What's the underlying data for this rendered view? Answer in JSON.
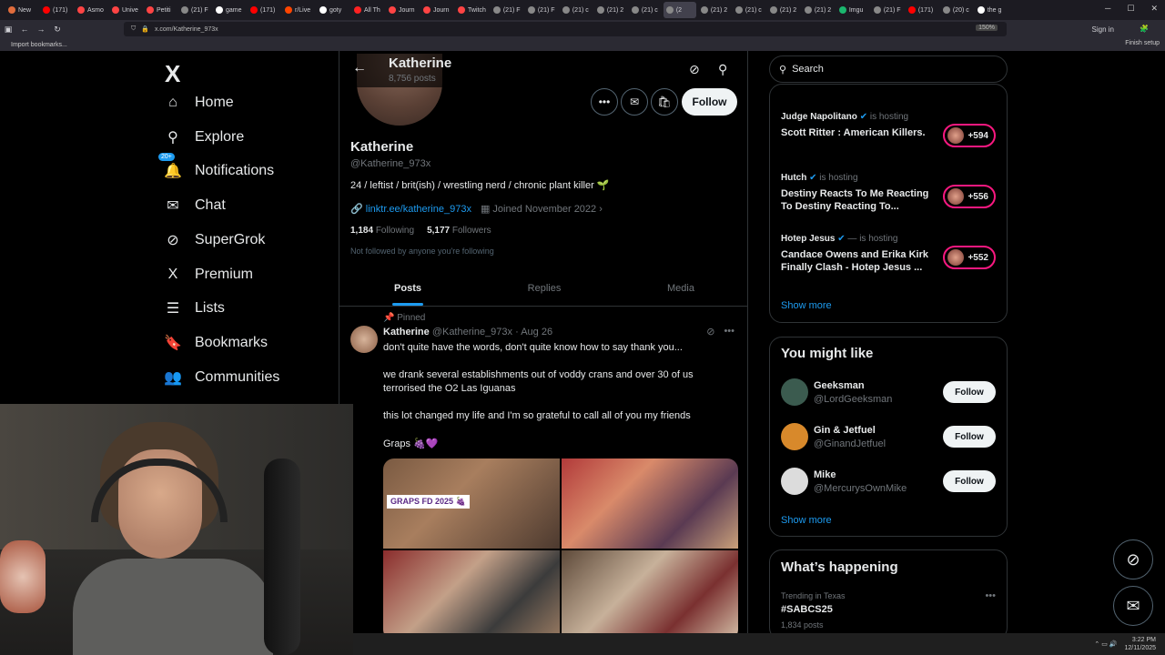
{
  "browser": {
    "tabs": [
      {
        "label": "New",
        "color": "#e06c3c"
      },
      {
        "label": "(171)",
        "color": "#ff0000"
      },
      {
        "label": "Asmo",
        "color": "#ff4444"
      },
      {
        "label": "Unive",
        "color": "#ff4444"
      },
      {
        "label": "Petiti",
        "color": "#ff4444"
      },
      {
        "label": "(21) F",
        "color": "#888888"
      },
      {
        "label": "game",
        "color": "#ffffff"
      },
      {
        "label": "(171)",
        "color": "#ff0000"
      },
      {
        "label": "r/Live",
        "color": "#ff4500"
      },
      {
        "label": "goty",
        "color": "#ffffff"
      },
      {
        "label": "All Th",
        "color": "#ff2222"
      },
      {
        "label": "Journ",
        "color": "#ff4444"
      },
      {
        "label": "Journ",
        "color": "#ff4444"
      },
      {
        "label": "Twitch",
        "color": "#ff4444"
      },
      {
        "label": "(21) F",
        "color": "#888888"
      },
      {
        "label": "(21) F",
        "color": "#888888"
      },
      {
        "label": "(21) c",
        "color": "#888888"
      },
      {
        "label": "(21) 2",
        "color": "#888888"
      },
      {
        "label": "(21) c",
        "color": "#888888"
      },
      {
        "label": "(2",
        "color": "#888888"
      },
      {
        "label": "(21) 2",
        "color": "#888888"
      },
      {
        "label": "(21) c",
        "color": "#888888"
      },
      {
        "label": "(21) 2",
        "color": "#888888"
      },
      {
        "label": "(21) 2",
        "color": "#888888"
      },
      {
        "label": "Imgu",
        "color": "#1bb76e"
      },
      {
        "label": "(21) F",
        "color": "#888888"
      },
      {
        "label": "(171)",
        "color": "#ff0000"
      },
      {
        "label": "(20) c",
        "color": "#888888"
      },
      {
        "label": "the g",
        "color": "#ffffff"
      }
    ],
    "active_tab_index": 19,
    "url": "x.com/Katherine_973x",
    "zoom": "150%",
    "sign_in": "Sign in",
    "bookmark": "Import bookmarks...",
    "finish_setup": "Finish setup"
  },
  "left_nav": {
    "logo": "X",
    "items": [
      {
        "label": "Home",
        "icon": "home-icon",
        "glyph": "⌂"
      },
      {
        "label": "Explore",
        "icon": "search-icon",
        "glyph": "⚲"
      },
      {
        "label": "Notifications",
        "icon": "bell-icon",
        "glyph": "🔔"
      },
      {
        "label": "Chat",
        "icon": "mail-icon",
        "glyph": "✉"
      },
      {
        "label": "SuperGrok",
        "icon": "grok-icon",
        "glyph": "⊘"
      },
      {
        "label": "Premium",
        "icon": "x-premium-icon",
        "glyph": "X"
      },
      {
        "label": "Lists",
        "icon": "list-icon",
        "glyph": "☰"
      },
      {
        "label": "Bookmarks",
        "icon": "bookmark-icon",
        "glyph": "🔖"
      },
      {
        "label": "Communities",
        "icon": "communities-icon",
        "glyph": "👥"
      }
    ],
    "notif_badge": "20+"
  },
  "profile": {
    "header_name": "Katherine",
    "header_posts": "8,756 posts",
    "follow_label": "Follow",
    "name": "Katherine",
    "handle": "@Katherine_973x",
    "bio": "24 / leftist / brit(ish) / wrestling nerd / chronic plant killer 🌱",
    "link": "linktr.ee/katherine_973x",
    "joined": "Joined November 2022",
    "following_count": "1,184",
    "following_label": "Following",
    "followers_count": "5,177",
    "followers_label": "Followers",
    "not_followed": "Not followed by anyone you're following",
    "tabs": [
      "Posts",
      "Replies",
      "Media"
    ]
  },
  "tweet": {
    "pinned_label": "Pinned",
    "author": "Katherine",
    "handle_date": "@Katherine_973x · Aug 26",
    "lines": [
      "don't quite have the words, don't quite know how to say thank you...",
      "we drank several establishments out of voddy crans and over 30 of us",
      "terrorised the O2 Las Iguanas",
      "this lot changed my life and I'm so grateful to call all of you my friends",
      "Graps 🍇💜"
    ],
    "media_label": "GRAPS FD 2025 🍇"
  },
  "right": {
    "search_placeholder": "Search",
    "spaces": [
      {
        "host": "Judge Napolitano",
        "hosting": "is hosting",
        "title": "Scott Ritter : American Killers.",
        "count": "+594"
      },
      {
        "host": "Hutch",
        "hosting": "is hosting",
        "title": "Destiny Reacts To Me Reacting To Destiny Reacting To...",
        "count": "+556"
      },
      {
        "host": "Hotep Jesus",
        "hosting": "— is hosting",
        "title": "Candace Owens and Erika Kirk Finally Clash - Hotep Jesus ...",
        "count": "+552"
      }
    ],
    "show_more": "Show more",
    "wtf_title": "You might like",
    "wtf": [
      {
        "name": "Geeksman",
        "handle": "@LordGeeksman",
        "btn": "Follow",
        "color": "#3b5b4f"
      },
      {
        "name": "Gin & Jetfuel",
        "handle": "@GinandJetfuel",
        "btn": "Follow",
        "color": "#d8892b"
      },
      {
        "name": "Mike",
        "handle": "@MercurysOwnMike",
        "btn": "Follow",
        "color": "#dcdcdc"
      }
    ],
    "show_more2": "Show more",
    "happening_title": "What’s happening",
    "trend_loc": "Trending in Texas",
    "trend_tag": "#SABCS25",
    "trend_count": "1,834 posts"
  },
  "taskbar": {
    "time": "3:22 PM",
    "date": "12/11/2025"
  }
}
